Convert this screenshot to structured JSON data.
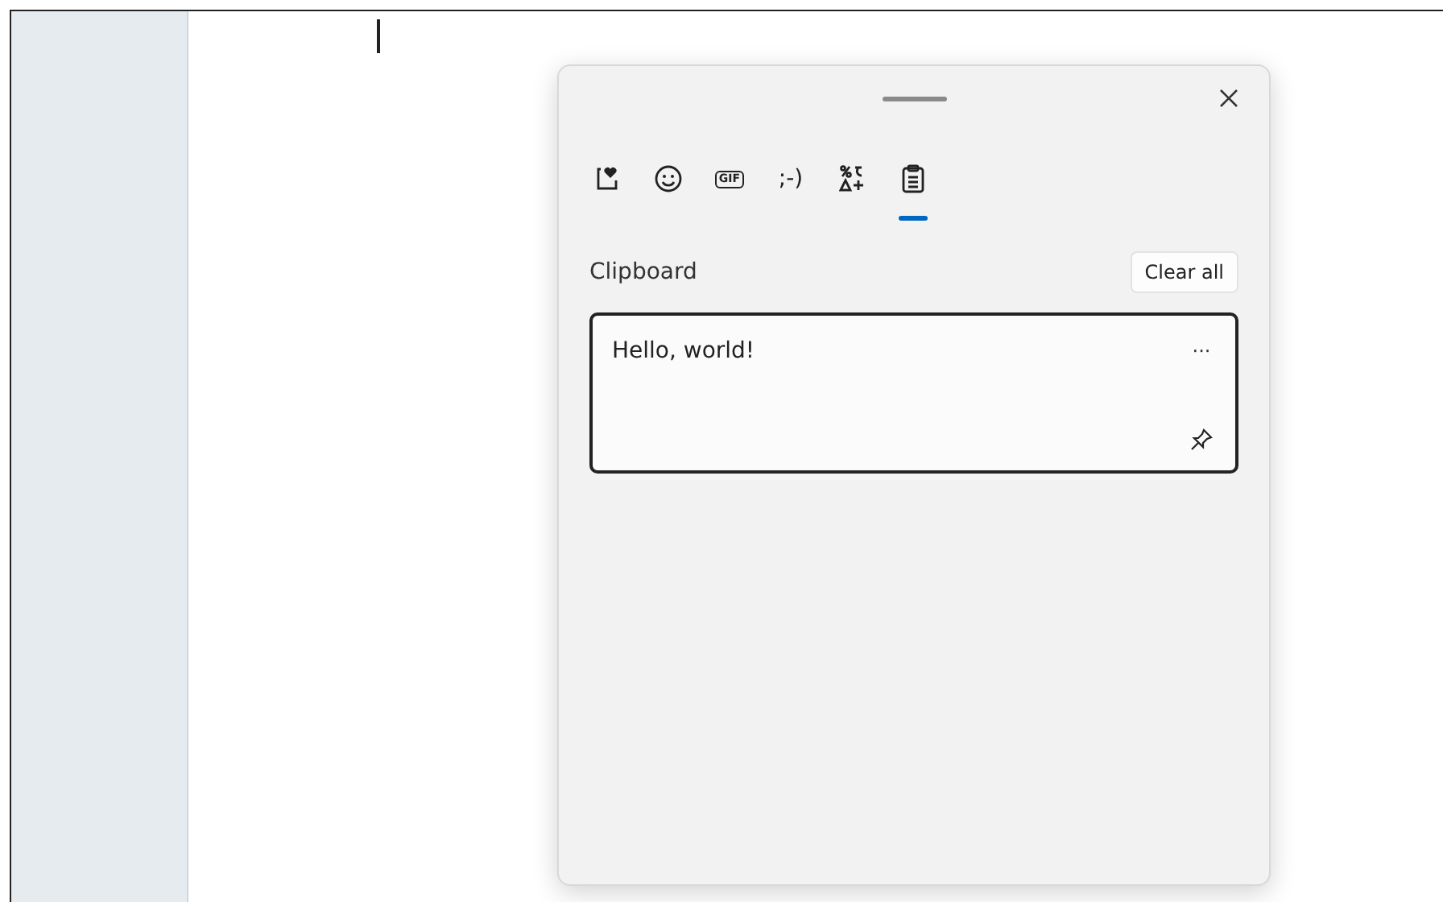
{
  "tabs": [
    {
      "kind": "kaomoji-heart",
      "selected": false
    },
    {
      "kind": "emoji",
      "selected": false
    },
    {
      "kind": "gif",
      "label": "GIF",
      "selected": false
    },
    {
      "kind": "text",
      "label": ";-)",
      "selected": false
    },
    {
      "kind": "symbols",
      "selected": false
    },
    {
      "kind": "clipboard",
      "selected": true
    }
  ],
  "section_title": "Clipboard",
  "clear_button": "Clear all",
  "items": [
    {
      "text": "Hello, world!",
      "more": "···",
      "pinned": false
    }
  ]
}
